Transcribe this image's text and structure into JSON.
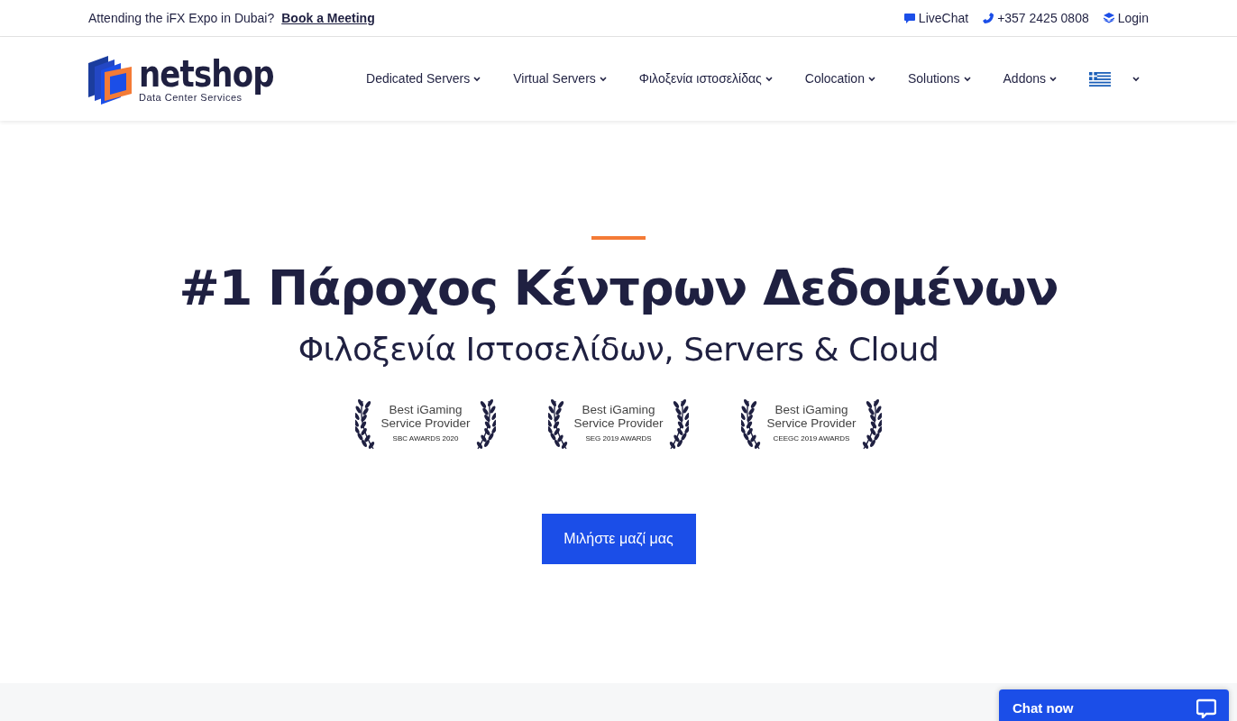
{
  "top_bar": {
    "announcement": "Attending the iFX Expo in Dubai?",
    "announcement_link": "Book a Meeting",
    "links": [
      {
        "kind": "chat",
        "label": "LiveChat"
      },
      {
        "kind": "phone",
        "label": "+357 2425 0808"
      },
      {
        "kind": "login",
        "label": "Login"
      }
    ]
  },
  "logo": {
    "name": "netshop",
    "tagline": "Data Center Services"
  },
  "nav": [
    {
      "label": "Dedicated Servers"
    },
    {
      "label": "Virtual Servers"
    },
    {
      "label": "Φιλοξενία ιστοσελίδας"
    },
    {
      "label": "Colocation"
    },
    {
      "label": "Solutions"
    },
    {
      "label": "Addons"
    }
  ],
  "hero": {
    "title": "#1 Πάροχος Κέντρων Δεδομένων",
    "subtitle": "Φιλοξενία Ιστοσελίδων, Servers & Cloud",
    "awards": [
      {
        "line1": "Best iGaming",
        "line2": "Service Provider",
        "source": "SBC AWARDS 2020"
      },
      {
        "line1": "Best iGaming",
        "line2": "Service Provider",
        "source": "SEG 2019 AWARDS"
      },
      {
        "line1": "Best iGaming",
        "line2": "Service Provider",
        "source": "CEEGC 2019 AWARDS"
      }
    ],
    "button": "Μιλήστε μαζί μας"
  },
  "chat_widget": {
    "label": "Chat now"
  }
}
